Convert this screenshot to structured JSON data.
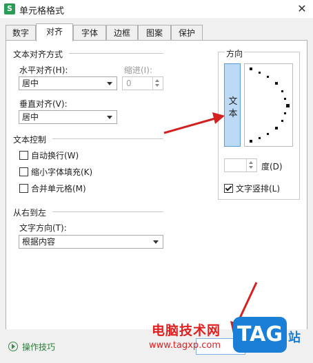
{
  "window": {
    "title": "单元格格式",
    "app_icon_letter": "S",
    "close_glyph": "✕"
  },
  "tabs": [
    {
      "label": "数字"
    },
    {
      "label": "对齐",
      "active": true
    },
    {
      "label": "字体"
    },
    {
      "label": "边框"
    },
    {
      "label": "图案"
    },
    {
      "label": "保护"
    }
  ],
  "text_alignment": {
    "section_title": "文本对齐方式",
    "horizontal_label": "水平对齐(H):",
    "horizontal_value": "居中",
    "indent_label": "缩进(I):",
    "indent_value": "0",
    "vertical_label": "垂直对齐(V):",
    "vertical_value": "居中"
  },
  "text_control": {
    "section_title": "文本控制",
    "options": [
      {
        "label": "自动换行(W)",
        "checked": false
      },
      {
        "label": "缩小字体填充(K)",
        "checked": false
      },
      {
        "label": "合并单元格(M)",
        "checked": false
      }
    ]
  },
  "rtl": {
    "section_title": "从右到左",
    "direction_label": "文字方向(T):",
    "direction_value": "根据内容"
  },
  "orientation": {
    "section_title": "方向",
    "vertical_text_chars": [
      "文",
      "本"
    ],
    "degree_value": "",
    "degree_label": "度(D)",
    "stacked_text_label": "文字竖排(L)",
    "stacked_text_checked": true
  },
  "footer": {
    "tips_label": "操作技巧"
  },
  "watermark": {
    "site_name": "电脑技术网",
    "url": "www.tagxp.com",
    "badge": "TAG",
    "suffix": "站"
  },
  "colors": {
    "accent": "#5a9ad6",
    "selected_fill": "#bcd9f5",
    "watermark_red": "#e02020",
    "watermark_blue": "#1a7fd6",
    "arrow_red": "#d42020",
    "tips_green": "#2a7a3a"
  }
}
